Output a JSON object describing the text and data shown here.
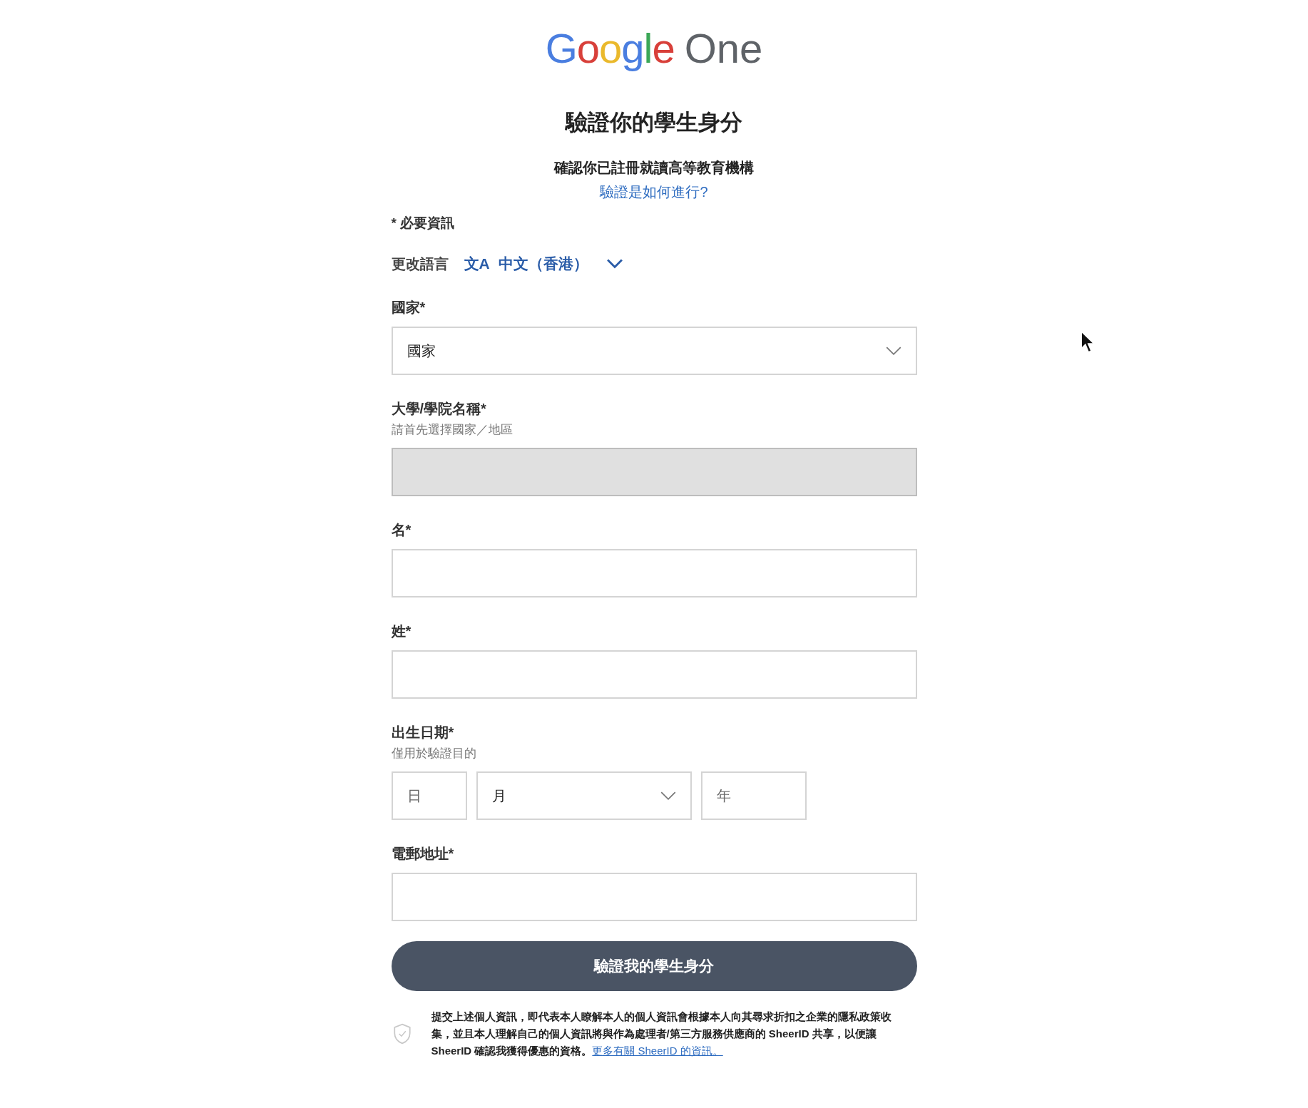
{
  "logo": {
    "brand": "Google",
    "product": "One"
  },
  "title": "驗證你的學生身分",
  "subtitle": "確認你已註冊就讀高等教育機構",
  "help_link": "驗證是如何進行?",
  "required_note": "* 必要資訊",
  "language": {
    "label": "更改語言",
    "icon": "文A",
    "value": "中文（香港）"
  },
  "fields": [
    {
      "kind": "select",
      "label": "國家*",
      "placeholder": "國家",
      "disabled": false
    },
    {
      "kind": "text",
      "label": "大學/學院名稱*",
      "hint": "請首先選擇國家／地區",
      "disabled": true
    },
    {
      "kind": "text",
      "label": "名*",
      "disabled": false
    },
    {
      "kind": "text",
      "label": "姓*",
      "disabled": false
    },
    {
      "kind": "date",
      "label": "出生日期*",
      "hint": "僅用於驗證目的",
      "parts": [
        {
          "kind": "text",
          "placeholder": "日"
        },
        {
          "kind": "select",
          "placeholder": "月"
        },
        {
          "kind": "text",
          "placeholder": "年"
        }
      ]
    },
    {
      "kind": "text",
      "label": "電郵地址*",
      "disabled": false
    }
  ],
  "submit_button": "驗證我的學生身分",
  "consent": {
    "text": "提交上述個人資訊，即代表本人瞭解本人的個人資訊會根據本人向其尋求折扣之企業的隱私政策收集，並且本人理解自己的個人資訊將與作為處理者/第三方服務供應商的 SheerID 共享，以便讓 SheerID 確認我獲得優惠的資格。",
    "link": "更多有關 SheerID 的資訊。"
  }
}
